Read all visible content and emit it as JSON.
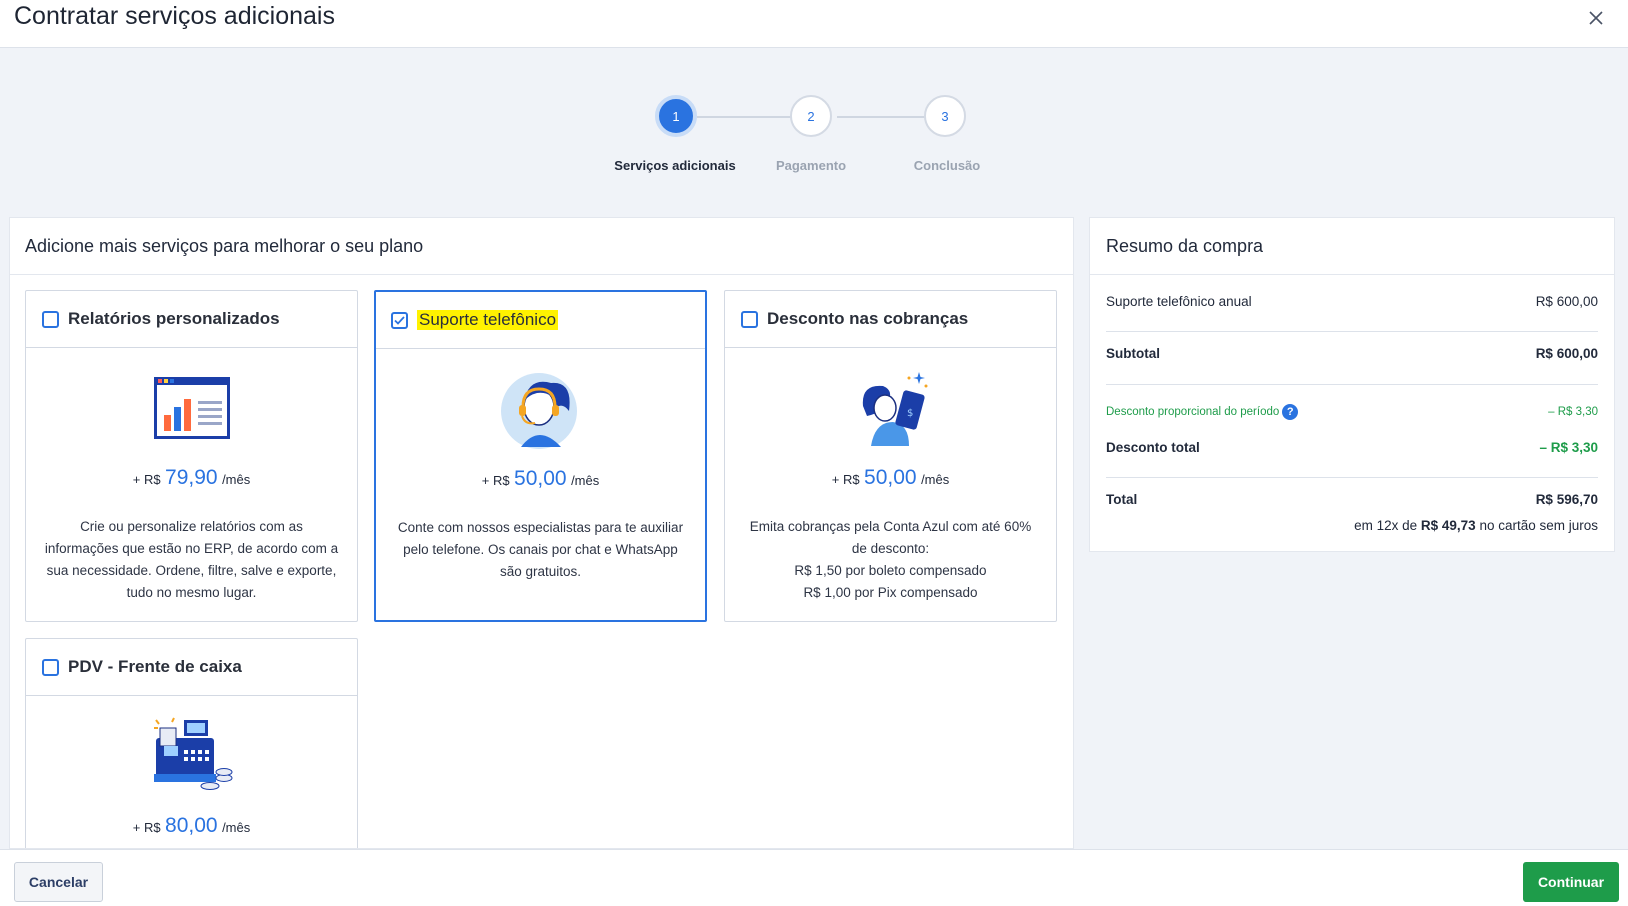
{
  "header": {
    "title": "Contratar serviços adicionais",
    "close_icon": "close-icon"
  },
  "stepper": {
    "steps": [
      {
        "number": "1",
        "label": "Serviços adicionais",
        "state": "active"
      },
      {
        "number": "2",
        "label": "Pagamento",
        "state": "pending"
      },
      {
        "number": "3",
        "label": "Conclusão",
        "state": "pending"
      }
    ]
  },
  "services": {
    "title": "Adicione mais serviços para melhorar o seu plano",
    "cards": [
      {
        "title": "Relatórios personalizados",
        "checked": false,
        "icon": "report-chart-icon",
        "price_prefix": "+ R$",
        "price_value": "79,90",
        "price_suffix": "/mês",
        "description": [
          "Crie ou personalize relatórios com as",
          "informações que estão no ERP, de acordo com a",
          "sua necessidade. Ordene, filtre, salve e exporte,",
          "tudo no mesmo lugar."
        ]
      },
      {
        "title": "Suporte telefônico",
        "checked": true,
        "icon": "headset-support-icon",
        "price_prefix": "+ R$",
        "price_value": "50,00",
        "price_suffix": "/mês",
        "description": [
          "Conte com nossos especialistas para te auxiliar",
          "pelo telefone. Os canais por chat e WhatsApp",
          "são gratuitos."
        ]
      },
      {
        "title": "Desconto nas cobranças",
        "checked": false,
        "icon": "billing-discount-icon",
        "price_prefix": "+ R$",
        "price_value": "50,00",
        "price_suffix": "/mês",
        "description": [
          "Emita cobranças pela Conta Azul com até 60%",
          "de desconto:",
          "R$ 1,50 por boleto compensado",
          "R$ 1,00 por Pix compensado"
        ]
      },
      {
        "title": "PDV - Frente de caixa",
        "checked": false,
        "icon": "cash-register-icon",
        "price_prefix": "+ R$",
        "price_value": "80,00",
        "price_suffix": "/mês",
        "description": []
      }
    ]
  },
  "summary": {
    "title": "Resumo da compra",
    "item_label": "Suporte telefônico anual",
    "item_value": "R$ 600,00",
    "subtotal_label": "Subtotal",
    "subtotal_value": "R$ 600,00",
    "prorated_label": "Desconto proporcional do período",
    "prorated_value": "– R$ 3,30",
    "discount_label": "Desconto total",
    "discount_value": "– R$ 3,30",
    "total_label": "Total",
    "total_value": "R$ 596,70",
    "installments_pre": "em 12x de",
    "installments_value": "R$ 49,73",
    "installments_post": "no cartão sem juros"
  },
  "footer": {
    "cancel_label": "Cancelar",
    "continue_label": "Continuar"
  },
  "colors": {
    "primary": "#2a73e0",
    "success": "#1e9c4a",
    "highlight": "#fff200"
  }
}
